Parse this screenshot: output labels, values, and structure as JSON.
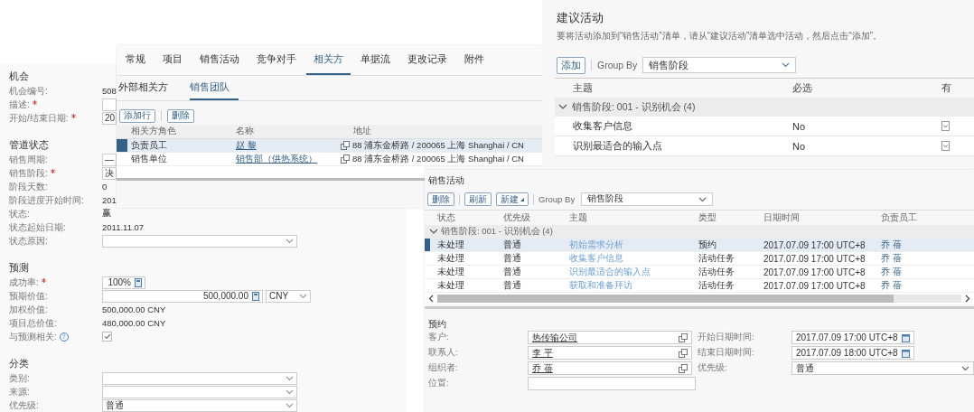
{
  "opportunity_form": {
    "sections": [
      {
        "title": "机会",
        "rows": [
          {
            "label": "机会编号:",
            "required": false,
            "kind": "text",
            "value": "508"
          },
          {
            "label": "描述:",
            "required": true,
            "kind": "field"
          },
          {
            "label": "开始/结束日期:",
            "required": true,
            "kind": "field",
            "value": "20"
          }
        ]
      },
      {
        "title": "管道状态",
        "rows": [
          {
            "label": "销售周期:",
            "required": false,
            "kind": "field",
            "value": "—"
          },
          {
            "label": "销售阶段:",
            "required": true,
            "kind": "field",
            "value": "决"
          },
          {
            "label": "阶段天数:",
            "required": false,
            "kind": "text",
            "value": "0"
          },
          {
            "label": "阶段进度开始时间:",
            "required": false,
            "kind": "text",
            "value": "201"
          },
          {
            "label": "状态:",
            "required": false,
            "kind": "text",
            "value": "赢"
          },
          {
            "label": "状态起始日期:",
            "required": false,
            "kind": "text",
            "value": "2011.11.07"
          },
          {
            "label": "状态原因:",
            "required": false,
            "kind": "select"
          }
        ]
      },
      {
        "title": "预测",
        "rows": [
          {
            "label": "成功率:",
            "required": true,
            "kind": "number",
            "value": "100%"
          },
          {
            "label": "预期价值:",
            "required": false,
            "kind": "currency",
            "value": "500,000.00",
            "currency": "CNY"
          },
          {
            "label": "加权价值:",
            "required": false,
            "kind": "text",
            "value": "500,000.00 CNY"
          },
          {
            "label": "项目总价值:",
            "required": false,
            "kind": "text",
            "value": "480,000.00 CNY"
          },
          {
            "label": "与预测相关:",
            "required": false,
            "kind": "checkbox",
            "checked": true,
            "help": "?"
          }
        ]
      },
      {
        "title": "分类",
        "rows": [
          {
            "label": "类别:",
            "required": false,
            "kind": "select"
          },
          {
            "label": "来源:",
            "required": false,
            "kind": "select"
          },
          {
            "label": "优先级:",
            "required": false,
            "kind": "select",
            "value": "普通"
          }
        ]
      }
    ]
  },
  "related_parties": {
    "tabs": [
      {
        "label": "常规",
        "selected": false
      },
      {
        "label": "项目",
        "selected": false
      },
      {
        "label": "销售活动",
        "selected": false
      },
      {
        "label": "竞争对手",
        "selected": false
      },
      {
        "label": "相关方",
        "selected": true
      },
      {
        "label": "单据流",
        "selected": false
      },
      {
        "label": "更改记录",
        "selected": false
      },
      {
        "label": "附件",
        "selected": false
      }
    ],
    "subtabs": [
      {
        "label": "外部相关方",
        "selected": false
      },
      {
        "label": "销售团队",
        "selected": true
      }
    ],
    "buttons": [
      "添加行",
      "删除"
    ],
    "columns": [
      "相关方角色",
      "名称",
      "地址"
    ],
    "rows": [
      {
        "selected": true,
        "role": "负责员工",
        "name": "赵 黎",
        "address": "88 浦东金桥路 / 200065 上海 Shanghai / CN"
      },
      {
        "selected": false,
        "role": "销售单位",
        "name": "销售部（供热系统）",
        "address": "88 浦东金桥路 / 200065 上海 Shanghai / CN"
      }
    ]
  },
  "suggested_activities": {
    "title": "建议活动",
    "description": "要将活动添加到“销售活动”清单，请从“建议活动”清单选中活动，然后点击“添加”。",
    "add_button": "添加",
    "group_by_label": "Group By",
    "group_by": "销售阶段",
    "columns": [
      "主题",
      "必选",
      "有"
    ],
    "group": {
      "label": "销售阶段: 001 - 识别机会 (4)",
      "expanded": true
    },
    "rows": [
      {
        "subject": "收集客户信息",
        "mandatory": "No"
      },
      {
        "subject": "识别最适合的输入点",
        "mandatory": "No"
      }
    ]
  },
  "sales_activities": {
    "title": "销售活动",
    "buttons": [
      "删除",
      "刷新",
      "新建"
    ],
    "group_by_label": "Group By",
    "group_by": "销售阶段",
    "columns": [
      "状态",
      "优先级",
      "主题",
      "类型",
      "日期时间",
      "负责员工"
    ],
    "group": {
      "label": "销售阶段: 001 - 识别机会 (4)",
      "expanded": true
    },
    "rows": [
      {
        "selected": true,
        "status": "未处理",
        "priority": "普通",
        "subject": "初始需求分析",
        "type": "预约",
        "datetime": "2017.07.09 17:00 UTC+8",
        "owner": "乔 蓓"
      },
      {
        "selected": false,
        "status": "未处理",
        "priority": "普通",
        "subject": "收集客户信息",
        "type": "活动任务",
        "datetime": "2017.07.09 17:00 UTC+8",
        "owner": "乔 蓓"
      },
      {
        "selected": false,
        "status": "未处理",
        "priority": "普通",
        "subject": "识别最适合的输入点",
        "type": "活动任务",
        "datetime": "2017.07.09 17:00 UTC+8",
        "owner": "乔 蓓"
      },
      {
        "selected": false,
        "status": "未处理",
        "priority": "普通",
        "subject": "获取和准备拜访",
        "type": "活动任务",
        "datetime": "2017.07.09 17:00 UTC+8",
        "owner": "乔 蓓"
      }
    ],
    "appointment": {
      "title": "预约",
      "fields": [
        {
          "label": "客户:",
          "kind": "link",
          "value": "热传输公司"
        },
        {
          "label": "开始日期时间:",
          "kind": "date",
          "value": "2017.07.09 17:00 UTC+8"
        },
        {
          "label": "联系人:",
          "kind": "link",
          "value": "李 平"
        },
        {
          "label": "结束日期时间:",
          "kind": "date",
          "value": "2017.07.09 18:00 UTC+8"
        },
        {
          "label": "组织者:",
          "kind": "link",
          "value": "乔 蓓"
        },
        {
          "label": "优先级:",
          "kind": "select",
          "value": "普通"
        },
        {
          "label": "位置:",
          "kind": "input"
        }
      ]
    }
  }
}
